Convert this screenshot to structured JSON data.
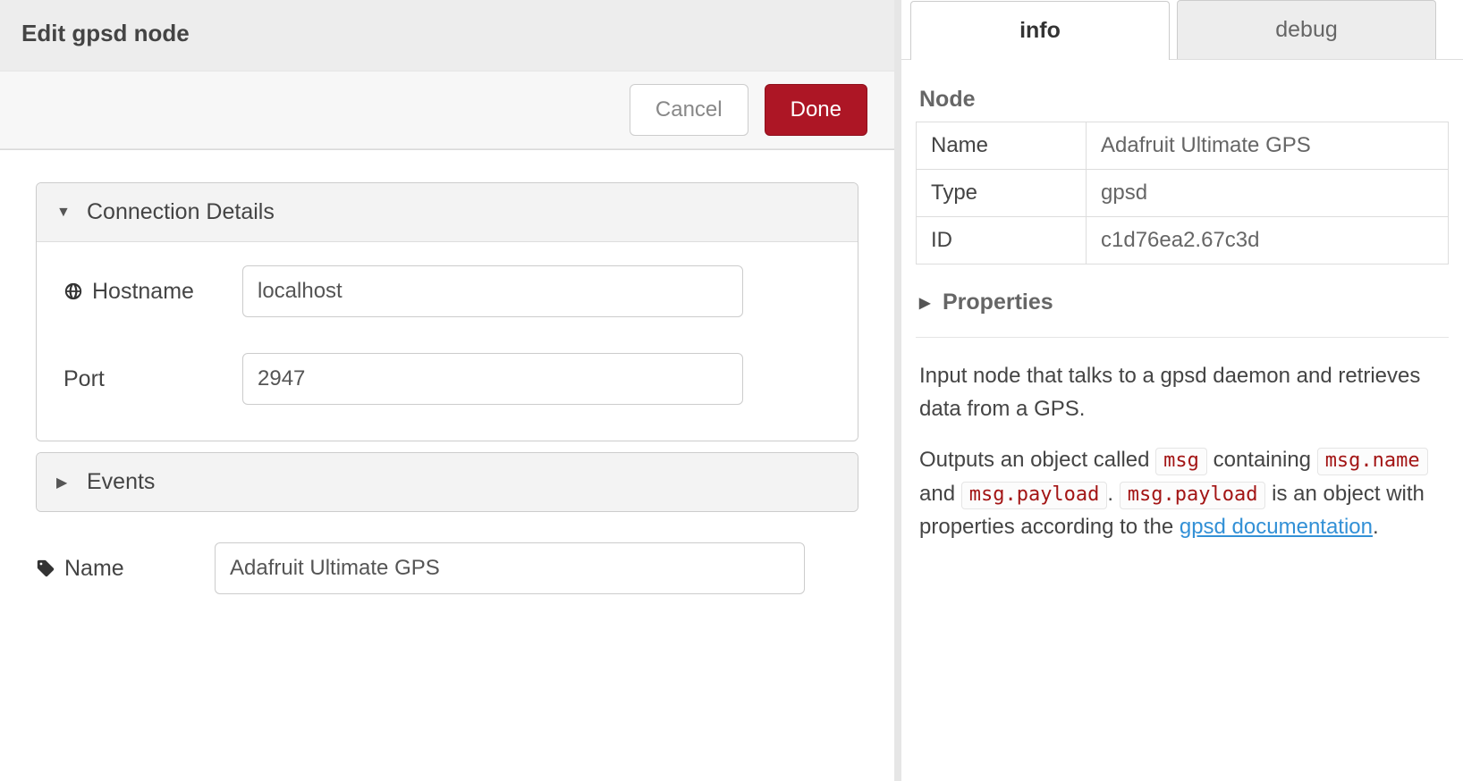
{
  "editor": {
    "title": "Edit gpsd node",
    "cancel_label": "Cancel",
    "done_label": "Done",
    "sections": {
      "connection": {
        "title": "Connection Details",
        "hostname_label": "Hostname",
        "hostname_value": "localhost",
        "port_label": "Port",
        "port_value": "2947"
      },
      "events": {
        "title": "Events"
      }
    },
    "name_label": "Name",
    "name_value": "Adafruit Ultimate GPS"
  },
  "sidebar": {
    "tabs": {
      "info": "info",
      "debug": "debug"
    },
    "node_heading": "Node",
    "node_table": {
      "name_key": "Name",
      "name_val": "Adafruit Ultimate GPS",
      "type_key": "Type",
      "type_val": "gpsd",
      "id_key": "ID",
      "id_val": "c1d76ea2.67c3d"
    },
    "properties_label": "Properties",
    "help": {
      "p1": "Input node that talks to a gpsd daemon and retrieves data from a GPS.",
      "p2_a": "Outputs an object called ",
      "p2_code1": "msg",
      "p2_b": " containing ",
      "p2_code2": "msg.name",
      "p2_c": " and ",
      "p2_code3": "msg.payload",
      "p2_d": ". ",
      "p2_code4": "msg.payload",
      "p2_e": " is an object with properties according to the ",
      "p2_link": "gpsd documentation",
      "p2_f": "."
    }
  }
}
